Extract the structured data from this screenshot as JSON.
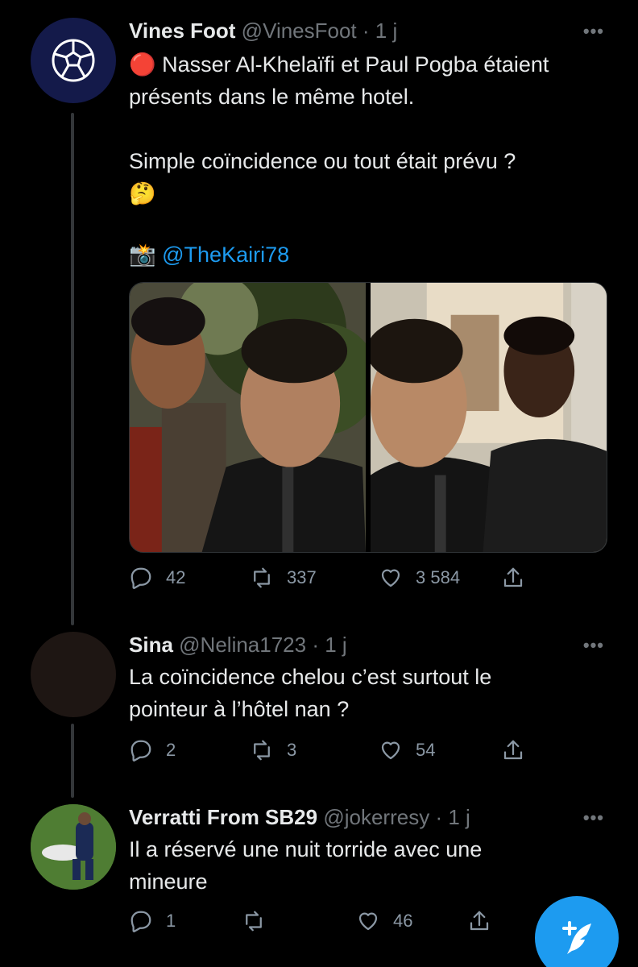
{
  "tweets": [
    {
      "name": "Vines Foot",
      "handle": "@VinesFoot",
      "time": "· 1 j",
      "more": "•••",
      "lines": [
        "🔴 Nasser Al-Khelaïfi et Paul Pogba étaient",
        "présents dans le même hotel.",
        "",
        "Simple coïncidence ou tout était prévu ?",
        "🤔",
        "",
        "📸 "
      ],
      "mention": "@TheKairi78",
      "replies": "42",
      "retweets": "337",
      "likes": "3 584"
    },
    {
      "name": "Sina",
      "handle": "@Nelina1723",
      "time": "· 1 j",
      "more": "•••",
      "lines": [
        "La coïncidence chelou c’est surtout le",
        "pointeur à l’hôtel nan ?"
      ],
      "replies": "2",
      "retweets": "3",
      "likes": "54"
    },
    {
      "name": "Verratti From SB29",
      "handle": "@jokerresy",
      "time": "· 1 j",
      "more": "•••",
      "lines": [
        "Il a réservé une nuit torride avec une",
        "mineure"
      ],
      "replies": "1",
      "retweets": "",
      "likes": "46"
    }
  ],
  "icons": {
    "reply": "reply-icon",
    "retweet": "retweet-icon",
    "like": "heart-icon",
    "share": "share-icon",
    "compose": "compose-tweet-icon",
    "logo": "soccer-ball-icon"
  },
  "colors": {
    "background": "#000000",
    "text": "#e7e9ea",
    "muted": "#71767b",
    "link": "#1d9bf0",
    "accent": "#1d9bf0",
    "avatar1": "#141a4a"
  }
}
